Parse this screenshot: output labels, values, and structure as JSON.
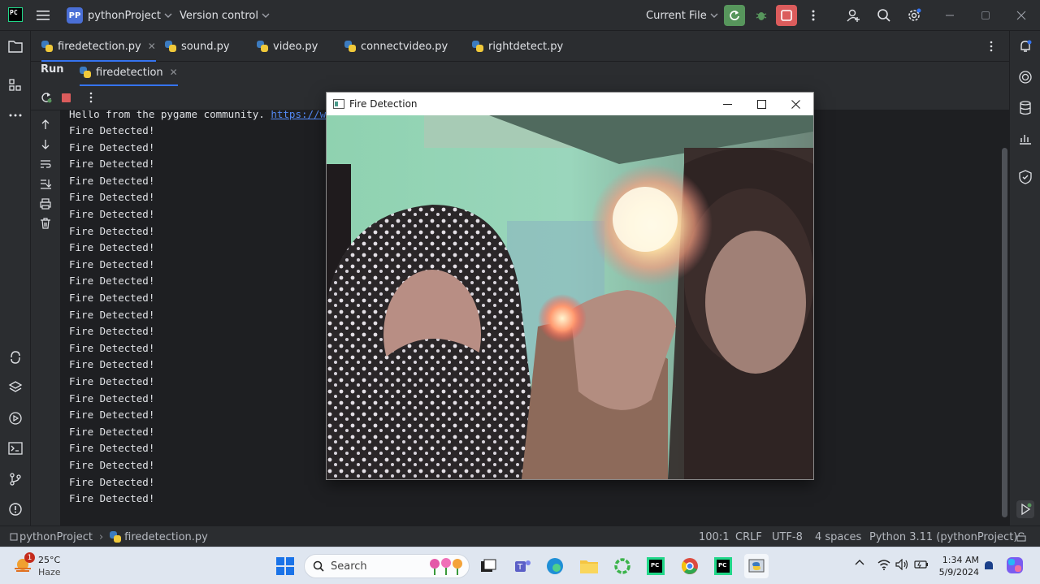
{
  "titlebar": {
    "project_badge": "PP",
    "project_name": "pythonProject",
    "vcs_label": "Version control",
    "run_config": "Current File"
  },
  "tabs": [
    {
      "label": "firedetection.py",
      "active": true
    },
    {
      "label": "sound.py"
    },
    {
      "label": "video.py"
    },
    {
      "label": "connectvideo.py"
    },
    {
      "label": "rightdetect.py"
    }
  ],
  "run_panel": {
    "title": "Run",
    "tab_label": "firedetection"
  },
  "console": {
    "first_line_text": "Hello from the pygame community. ",
    "first_line_link": "https://w",
    "repeated_line": "Fire Detected!",
    "lines": [
      "Fire Detected!",
      "Fire Detected!",
      "Fire Detected!",
      "Fire Detected!",
      "Fire Detected!",
      "Fire Detected!",
      "Fire Detected!",
      "Fire Detected!",
      "Fire Detected!",
      "Fire Detected!",
      "Fire Detected!",
      "Fire Detected!",
      "Fire Detected!",
      "Fire Detected!",
      "Fire Detected!",
      "Fire Detected!",
      "Fire Detected!",
      "Fire Detected!",
      "Fire Detected!",
      "Fire Detected!",
      "Fire Detected!",
      "Fire Detected!",
      "Fire Detected!"
    ]
  },
  "window": {
    "title": "Fire Detection"
  },
  "statusbar": {
    "breadcrumb_project": "pythonProject",
    "breadcrumb_file": "firedetection.py",
    "position": "100:1",
    "line_sep": "CRLF",
    "encoding": "UTF-8",
    "indent": "4 spaces",
    "interpreter": "Python 3.11 (pythonProject)"
  },
  "taskbar": {
    "weather_temp": "25°C",
    "weather_desc": "Haze",
    "weather_badge": "1",
    "search_placeholder": "Search",
    "time": "1:34 AM",
    "date": "5/9/2024"
  },
  "colors": {
    "accent": "#3574f0",
    "run_green": "#57965c",
    "stop_red": "#db5c5c",
    "link": "#548af7"
  }
}
